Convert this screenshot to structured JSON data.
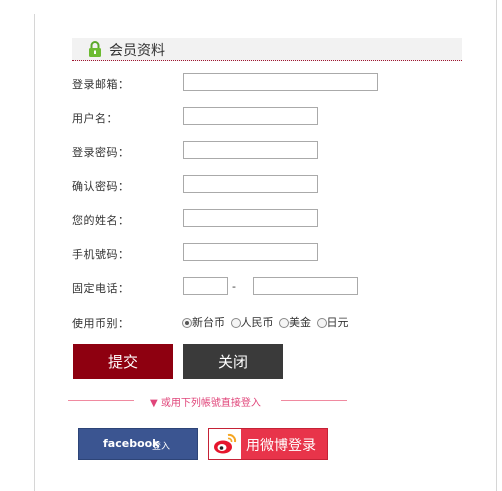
{
  "section": {
    "title": "会员资料",
    "icon": "lock-icon"
  },
  "form": {
    "email_label": "登录邮箱：",
    "username_label": "用户名：",
    "password_label": "登录密码：",
    "confirm_label": "确认密码：",
    "name_label": "您的姓名：",
    "mobile_label": "手机號码：",
    "phone_label": "固定电话：",
    "phone_separator": "-",
    "currency_label": "使用币别：",
    "currency_options": [
      {
        "label": "新台币",
        "selected": true
      },
      {
        "label": "人民币",
        "selected": false
      },
      {
        "label": "美金",
        "selected": false
      },
      {
        "label": "日元",
        "selected": false
      }
    ]
  },
  "buttons": {
    "submit": "提交",
    "close": "关闭"
  },
  "social": {
    "divider_text": "▼ 或用下列帳號直接登入",
    "facebook_name": "facebook",
    "facebook_login": "登入",
    "weibo_label": "用微博登录"
  },
  "colors": {
    "accent": "#8e0010",
    "dark": "#3a3a3a",
    "pink": "#e0457a",
    "facebook": "#3b5591",
    "weibo": "#e8344a"
  }
}
